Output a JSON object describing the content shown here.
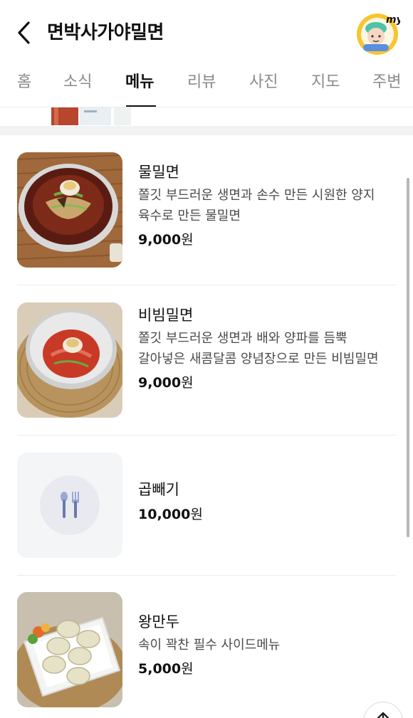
{
  "header": {
    "title": "면박사가야밀면",
    "my_label": "my"
  },
  "tabs": [
    {
      "label": "홈",
      "active": false
    },
    {
      "label": "소식",
      "active": false
    },
    {
      "label": "메뉴",
      "active": true
    },
    {
      "label": "리뷰",
      "active": false
    },
    {
      "label": "사진",
      "active": false
    },
    {
      "label": "지도",
      "active": false
    },
    {
      "label": "주변",
      "active": false
    }
  ],
  "menu": [
    {
      "name": "물밀면",
      "description": "쫄깃 부드러운 생면과 손수 만든 시원한 양지 육수로 만든 물밀면",
      "price": "9,000",
      "currency": "원",
      "image": "mulmilmyeon-photo"
    },
    {
      "name": "비빔밀면",
      "description": "쫄깃 부드러운 생면과 배와 양파를 듬뿍 갈아넣은 새콤달콤 양념장으로 만든 비빔밀면",
      "price": "9,000",
      "currency": "원",
      "image": "bibimmilmyeon-photo"
    },
    {
      "name": "곱빼기",
      "description": "",
      "price": "10,000",
      "currency": "원",
      "image": "utensils-placeholder-icon"
    },
    {
      "name": "왕만두",
      "description": "속이 꽉찬 필수 사이드메뉴",
      "price": "5,000",
      "currency": "원",
      "image": "wangmandu-photo"
    }
  ],
  "colors": {
    "active_tab": "#111111",
    "inactive_tab": "#8a8a8a",
    "divider": "#f1f2f4",
    "my_badge": "#f7c531"
  }
}
